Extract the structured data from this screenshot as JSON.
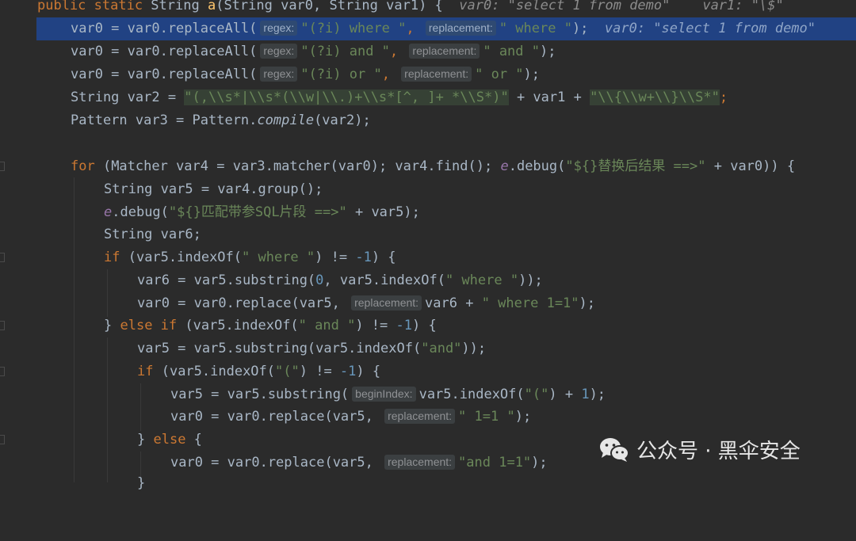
{
  "lines": {
    "l0": {
      "pre": "public static ",
      "t": "String ",
      "fn": "a",
      "p": "(String var0, String var1) {",
      "in1": "var0: \"select 1 from demo\"",
      "in2": "var1: \"\\$\""
    },
    "l1": {
      "a": "var0 = var0.replaceAll(",
      "h1": "regex:",
      "s1": "\"(?i) where \"",
      "c": ", ",
      "h2": "replacement:",
      "s2": "\" where \"",
      "e": ");",
      "in": "var0: \"select 1 from demo\""
    },
    "l2": {
      "a": "var0 = var0.replaceAll(",
      "h1": "regex:",
      "s1": "\"(?i) and \"",
      "c": ", ",
      "h2": "replacement:",
      "s2": "\" and \"",
      "e": ");"
    },
    "l3": {
      "a": "var0 = var0.replaceAll(",
      "h1": "regex:",
      "s1": "\"(?i) or \"",
      "c": ", ",
      "h2": "replacement:",
      "s2": "\" or \"",
      "e": ");"
    },
    "l4": {
      "a": "String var2 = ",
      "s1": "\"(,\\\\s*|\\\\s*(\\\\w|\\\\.)+\\\\s*[^, ]+ *\\\\S*)\"",
      "b": " + var1 + ",
      "s2": "\"\\\\{\\\\w+\\\\}\\\\S*\"",
      "e": ";"
    },
    "l5": {
      "a": "Pattern var3 = Pattern.",
      "m": "compile",
      "e": "(var2);"
    },
    "l7": {
      "k": "for ",
      "a": "(Matcher var4 = var3.matcher(var0); var4.find(); ",
      "v": "e",
      "b": ".debug(",
      "s": "\"${}替换后结果 ==>\"",
      "e": " + var0)) {"
    },
    "l8": {
      "a": "String var5 = var4.group();"
    },
    "l9": {
      "v": "e",
      "b": ".debug(",
      "s": "\"${}匹配带参SQL片段 ==>\"",
      "e": " + var5);"
    },
    "l10": {
      "a": "String var6;"
    },
    "l11": {
      "k": "if ",
      "a": "(var5.indexOf(",
      "s": "\" where \"",
      "b": ") != ",
      "n": "-1",
      "e": ") {"
    },
    "l12": {
      "a": "var6 = var5.substring(",
      "n": "0",
      "b": ", var5.indexOf(",
      "s": "\" where \"",
      "e": "));"
    },
    "l13": {
      "a": "var0 = var0.replace(var5, ",
      "h": "replacement:",
      "b": "var6 + ",
      "s": "\" where 1=1\"",
      "e": ");"
    },
    "l14": {
      "a": "} ",
      "k": "else if ",
      "b": "(var5.indexOf(",
      "s": "\" and \"",
      "c": ") != ",
      "n": "-1",
      "e": ") {"
    },
    "l15": {
      "a": "var5 = var5.substring(var5.indexOf(",
      "s": "\"and\"",
      "e": "));"
    },
    "l16": {
      "k": "if ",
      "a": "(var5.indexOf(",
      "s": "\"(\"",
      "b": ") != ",
      "n": "-1",
      "e": ") {"
    },
    "l17": {
      "a": "var5 = var5.substring(",
      "h": "beginIndex:",
      "b": "var5.indexOf(",
      "s": "\"(\"",
      "c": ") + ",
      "n": "1",
      "e": ");"
    },
    "l18": {
      "a": "var0 = var0.replace(var5, ",
      "h": "replacement:",
      "s": "\" 1=1 \"",
      "e": ");"
    },
    "l19": {
      "a": "} ",
      "k": "else ",
      "e": "{"
    },
    "l20": {
      "a": "var0 = var0.replace(var5, ",
      "h": "replacement:",
      "s": "\"and 1=1\"",
      "e": ");"
    },
    "l21": {
      "a": "}"
    }
  },
  "watermark": {
    "text": "公众号 · 黑伞安全",
    "logo": "wechat-logo"
  },
  "colors": {
    "keyword": "#cc7832",
    "string": "#6a8759",
    "number": "#6897bb",
    "highlight": "#214283",
    "background": "#2b2b2b"
  }
}
